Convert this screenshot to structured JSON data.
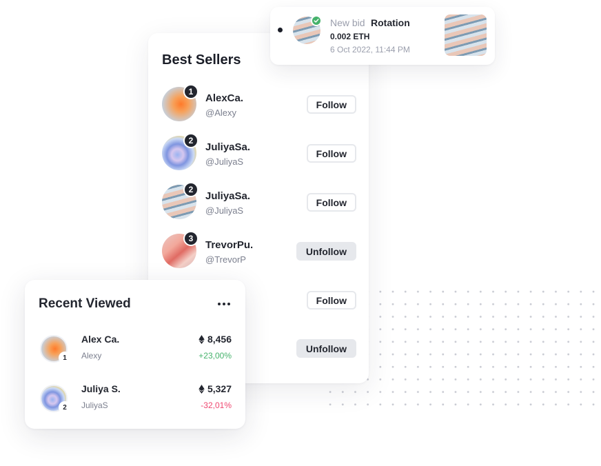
{
  "best_sellers": {
    "title": "Best Sellers",
    "rows": [
      {
        "rank": "1",
        "name": "AlexCa.",
        "handle": "@Alexy",
        "button": "Follow",
        "avatar_icon": "orange-gradient-avatar"
      },
      {
        "rank": "2",
        "name": "JuliyaSa.",
        "handle": "@JuliyaS",
        "button": "Follow",
        "avatar_icon": "holographic-avatar"
      },
      {
        "rank": "2",
        "name": "JuliyaSa.",
        "handle": "@JuliyaS",
        "button": "Follow",
        "avatar_icon": "rings-avatar"
      },
      {
        "rank": "3",
        "name": "TrevorPu.",
        "handle": "@TrevorP",
        "button": "Unfollow",
        "avatar_icon": "pink-waves-avatar"
      },
      {
        "rank": "",
        "name": "",
        "handle": "",
        "button": "Follow"
      },
      {
        "rank": "",
        "name": "",
        "handle": "",
        "button": "Unfollow"
      }
    ]
  },
  "bid": {
    "label": "New bid",
    "title": "Rotation",
    "amount": "0.002 ETH",
    "date": "6 Oct 2022, 11:44 PM",
    "status_icon": "unread-dot-icon",
    "verified_icon": "verified-check-icon"
  },
  "recent_viewed": {
    "title": "Recent Viewed",
    "menu_icon": "more-horizontal-icon",
    "currency_icon": "ethereum-icon",
    "rows": [
      {
        "rank": "1",
        "name": "Alex Ca.",
        "handle": "Alexy",
        "price": "8,456",
        "change": "+23,00%",
        "trend": "up"
      },
      {
        "rank": "2",
        "name": "Juliya S.",
        "handle": "JuliyaS",
        "price": "5,327",
        "change": "-32,01%",
        "trend": "down"
      }
    ]
  },
  "colors": {
    "positive": "#45b26b",
    "negative": "#ef466f",
    "badge_dark": "#23262f",
    "verified": "#45b26b"
  }
}
